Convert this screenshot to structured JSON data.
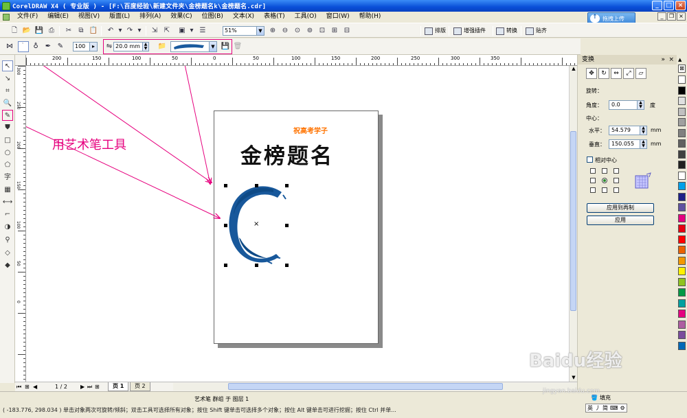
{
  "window": {
    "title": "CorelDRAW X4 ( 专业版 ) - [F:\\百度经验\\新建文件夹\\金榜题名k\\金榜题名.cdr]",
    "buttons": [
      "_",
      "□",
      "×"
    ]
  },
  "menu": [
    "文件(F)",
    "编辑(E)",
    "视图(V)",
    "版面(L)",
    "排列(A)",
    "效果(C)",
    "位图(B)",
    "文本(X)",
    "表格(T)",
    "工具(O)",
    "窗口(W)",
    "帮助(H)"
  ],
  "upload_widget": {
    "label": "拖拽上传"
  },
  "std_toolbar": {
    "zoom": "51%",
    "buttons": [
      "排版",
      "增强插件",
      "转换",
      "贴齐"
    ]
  },
  "property_bar": {
    "smoothing": "100",
    "width": "20.0 mm"
  },
  "toolbox": {
    "icons": [
      "pick-tool-icon",
      "shape-tool-icon",
      "crop-tool-icon",
      "zoom-tool-icon",
      "artistic-media-tool-icon",
      "smart-fill-icon",
      "rectangle-tool-icon",
      "ellipse-tool-icon",
      "polygon-tool-icon",
      "text-tool-icon",
      "table-tool-icon",
      "dimension-tool-icon",
      "connector-tool-icon",
      "interactive-blend-icon",
      "eyedropper-icon",
      "outline-tool-icon",
      "fill-tool-icon"
    ],
    "text_tool_glyph": "字"
  },
  "ruler": {
    "h_labels": [
      "200",
      "150",
      "100",
      "50",
      "0",
      "50",
      "100",
      "150",
      "200",
      "250",
      "300",
      "350"
    ],
    "v_labels": [
      "300",
      "250",
      "200",
      "150",
      "100",
      "50",
      "0"
    ]
  },
  "canvas": {
    "subtitle": "祝高考学子",
    "title": "金榜题名",
    "annotation": "用艺术笔工具"
  },
  "page_nav": {
    "position": "1 / 2",
    "tabs": [
      "页 1",
      "页 2"
    ]
  },
  "docker": {
    "title": "变换",
    "section": "旋转：",
    "angle_label": "角度：",
    "angle_value": "0.0",
    "angle_unit": "度",
    "center_label": "中心：",
    "h_label": "水平：",
    "h_value": "54.579",
    "v_label": "垂直：",
    "v_value": "150.055",
    "unit": "mm",
    "relative_center": "相对中心",
    "apply_copy": "应用到再制",
    "apply": "应用"
  },
  "palette_colors": [
    "#ffffff",
    "#000000",
    "#e0e0e0",
    "#c0c0c0",
    "#a0a0a0",
    "#808080",
    "#606060",
    "#404040",
    "#202020",
    "#ffffff",
    "#00a0e9",
    "#1d2088",
    "#5f52a0",
    "#e4007f",
    "#e60012",
    "#ff0000",
    "#eb6100",
    "#f39800",
    "#fff100",
    "#8fc31f",
    "#009944",
    "#00a0a0",
    "#e4007f",
    "#ae5da1",
    "#7a4b9c",
    "#0068b7"
  ],
  "status": {
    "object_info": "艺术笔 群组 于 图层 1",
    "coords": "( -183.776, 298.034 )",
    "hint": "单击对象两次可旋转/倾斜；双击工具可选择所有对象；按住 Shift 键单击可选择多个对象；按住 Alt 键单击可进行挖掘；按住 Ctrl 并单...",
    "fill_label": "填充",
    "ime": [
      "英",
      "丿",
      "简"
    ]
  },
  "watermark": {
    "brand": "Baidu经验",
    "url": "jingyan.baidu.com"
  }
}
